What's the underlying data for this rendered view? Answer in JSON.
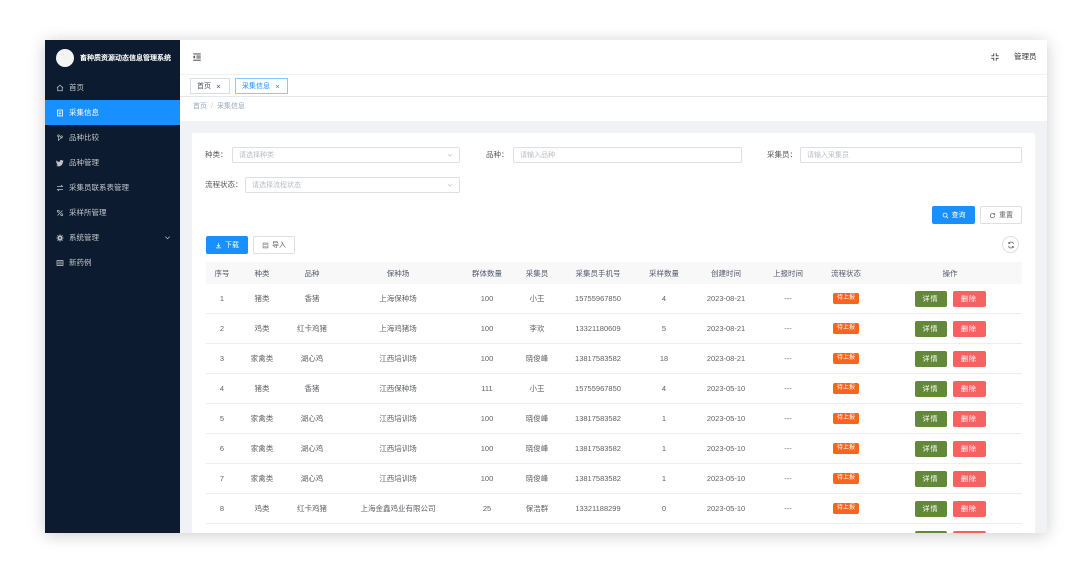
{
  "app": {
    "title": "畜种质资源动态信息管理系统",
    "user": "管理员"
  },
  "sidebar": {
    "items": [
      {
        "label": "首页",
        "icon": "home-icon"
      },
      {
        "label": "采集信息",
        "icon": "document-icon",
        "active": true
      },
      {
        "label": "品种比较",
        "icon": "branch-icon"
      },
      {
        "label": "品种管理",
        "icon": "bird-icon"
      },
      {
        "label": "采集员联系表管理",
        "icon": "swap-icon"
      },
      {
        "label": "采样所管理",
        "icon": "percent-icon"
      },
      {
        "label": "系统管理",
        "icon": "gear-icon",
        "expandable": true
      },
      {
        "label": "新药例",
        "icon": "grid-icon"
      }
    ]
  },
  "header": {
    "fold_icon": "menu-fold-icon",
    "fullscreen_icon": "fullscreen-icon"
  },
  "tabs": [
    {
      "label": "首页"
    },
    {
      "label": "采集信息",
      "active": true
    }
  ],
  "breadcrumb": {
    "home": "首页",
    "separator": "/",
    "current": "采集信息"
  },
  "search": {
    "species_label": "种类：",
    "species_placeholder": "请选择种类",
    "breed_label": "品种：",
    "breed_placeholder": "请输入品种",
    "collector_label": "采集员：",
    "collector_placeholder": "请输入采集员",
    "status_label": "流程状态：",
    "status_placeholder": "请选择流程状态",
    "query_label": "查询",
    "reset_label": "重置"
  },
  "toolbar": {
    "download_label": "下载",
    "import_label": "导入"
  },
  "table": {
    "columns": [
      "序号",
      "种类",
      "品种",
      "保种场",
      "群体数量",
      "采集员",
      "采集员手机号",
      "采样数量",
      "创建时间",
      "上报时间",
      "流程状态",
      "操作"
    ],
    "rows": [
      {
        "index": 1,
        "species": "猪类",
        "breed": "香猪",
        "farm": "上海保种场",
        "population": 100,
        "collector": "小王",
        "phone": "15755967850",
        "samples": 4,
        "created": "2023-08-21",
        "reported": "---",
        "status": "待上报"
      },
      {
        "index": 2,
        "species": "鸡类",
        "breed": "红卡鸡猪",
        "farm": "上海鸡猪场",
        "population": 100,
        "collector": "李欢",
        "phone": "13321180609",
        "samples": 5,
        "created": "2023-08-21",
        "reported": "---",
        "status": "待上报"
      },
      {
        "index": 3,
        "species": "家禽类",
        "breed": "湖心鸡",
        "farm": "江西培训场",
        "population": 100,
        "collector": "晓俊峰",
        "phone": "13817583582",
        "samples": 18,
        "created": "2023-08-21",
        "reported": "---",
        "status": "待上报"
      },
      {
        "index": 4,
        "species": "猪类",
        "breed": "香猪",
        "farm": "江西保种场",
        "population": 111,
        "collector": "小王",
        "phone": "15755967850",
        "samples": 4,
        "created": "2023-05-10",
        "reported": "---",
        "status": "待上报"
      },
      {
        "index": 5,
        "species": "家禽类",
        "breed": "湖心鸡",
        "farm": "江西培训场",
        "population": 100,
        "collector": "晓俊峰",
        "phone": "13817583582",
        "samples": 1,
        "created": "2023-05-10",
        "reported": "---",
        "status": "待上报"
      },
      {
        "index": 6,
        "species": "家禽类",
        "breed": "湖心鸡",
        "farm": "江西培训场",
        "population": 100,
        "collector": "晓俊峰",
        "phone": "13817583582",
        "samples": 1,
        "created": "2023-05-10",
        "reported": "---",
        "status": "待上报"
      },
      {
        "index": 7,
        "species": "家禽类",
        "breed": "湖心鸡",
        "farm": "江西培训场",
        "population": 100,
        "collector": "晓俊峰",
        "phone": "13817583582",
        "samples": 1,
        "created": "2023-05-10",
        "reported": "---",
        "status": "待上报"
      },
      {
        "index": 8,
        "species": "鸡类",
        "breed": "红卡鸡猪",
        "farm": "上海金鑫鸡业有限公司",
        "population": 25,
        "collector": "保浩群",
        "phone": "13321188299",
        "samples": 0,
        "created": "2023-05-10",
        "reported": "---",
        "status": "待上报"
      }
    ],
    "actions": {
      "detail": "详情",
      "delete": "删除"
    }
  },
  "colors": {
    "sidebar_bg": "#0c1b2f",
    "primary": "#1890ff",
    "status_tag": "#f7651e",
    "detail_button": "#64883a",
    "delete_button": "#f56262"
  }
}
